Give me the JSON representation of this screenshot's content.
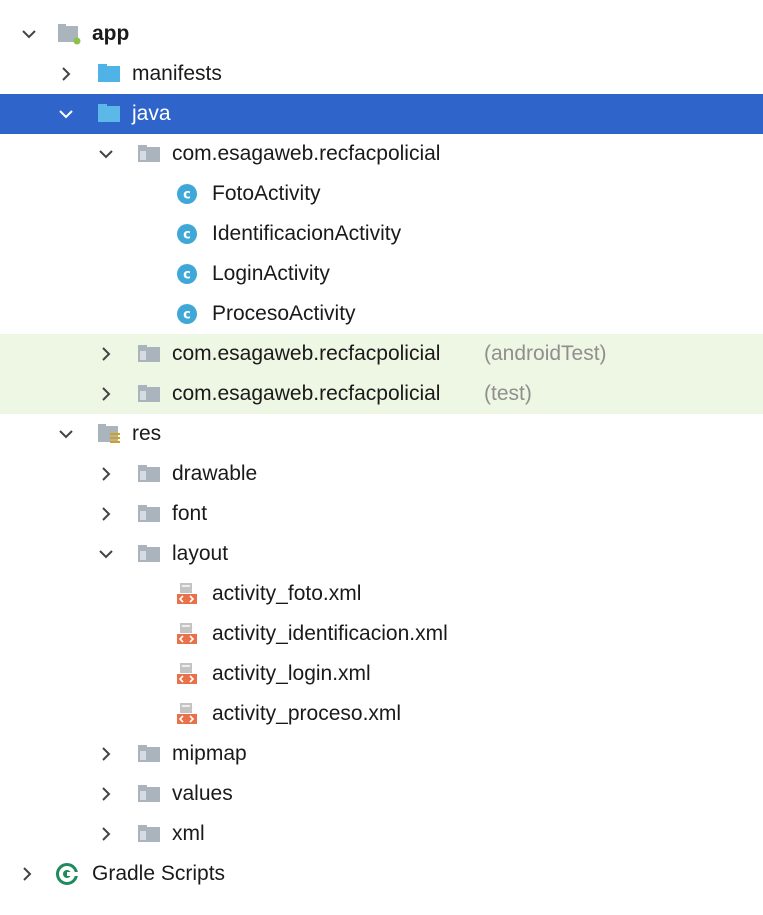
{
  "tree": {
    "app": {
      "label": "app",
      "icon": "android-module-folder-icon"
    },
    "manifests": {
      "label": "manifests",
      "icon": "folder-icon"
    },
    "java": {
      "label": "java",
      "icon": "source-folder-icon"
    },
    "pkg_main": {
      "label": "com.esagaweb.recfacpolicial",
      "icon": "package-icon"
    },
    "classes": [
      {
        "label": "FotoActivity",
        "icon": "class-c-icon"
      },
      {
        "label": "IdentificacionActivity",
        "icon": "class-c-icon"
      },
      {
        "label": "LoginActivity",
        "icon": "class-c-icon"
      },
      {
        "label": "ProcesoActivity",
        "icon": "class-c-icon"
      }
    ],
    "pkg_android_test": {
      "label": "com.esagaweb.recfacpolicial",
      "suffix": "(androidTest)",
      "icon": "package-icon"
    },
    "pkg_test": {
      "label": "com.esagaweb.recfacpolicial",
      "suffix": "(test)",
      "icon": "package-icon"
    },
    "res": {
      "label": "res",
      "icon": "resources-folder-icon"
    },
    "drawable": {
      "label": "drawable",
      "icon": "package-icon"
    },
    "font": {
      "label": "font",
      "icon": "package-icon"
    },
    "layout": {
      "label": "layout",
      "icon": "package-icon"
    },
    "layout_files": [
      {
        "label": "activity_foto.xml",
        "icon": "layout-xml-icon"
      },
      {
        "label": "activity_identificacion.xml",
        "icon": "layout-xml-icon"
      },
      {
        "label": "activity_login.xml",
        "icon": "layout-xml-icon"
      },
      {
        "label": "activity_proceso.xml",
        "icon": "layout-xml-icon"
      }
    ],
    "mipmap": {
      "label": "mipmap",
      "icon": "package-icon"
    },
    "values": {
      "label": "values",
      "icon": "package-icon"
    },
    "xml": {
      "label": "xml",
      "icon": "package-icon"
    },
    "gradle": {
      "label": "Gradle Scripts",
      "icon": "gradle-icon"
    }
  },
  "colors": {
    "selection": "#2f65ca",
    "test_tint": "#eef6e4",
    "folder_blue": "#4fb3e8",
    "package_gray": "#a9b4bd",
    "class_blue": "#40a8d8",
    "xml_orange": "#e8714a",
    "gradle_green": "#1f8a5b"
  }
}
